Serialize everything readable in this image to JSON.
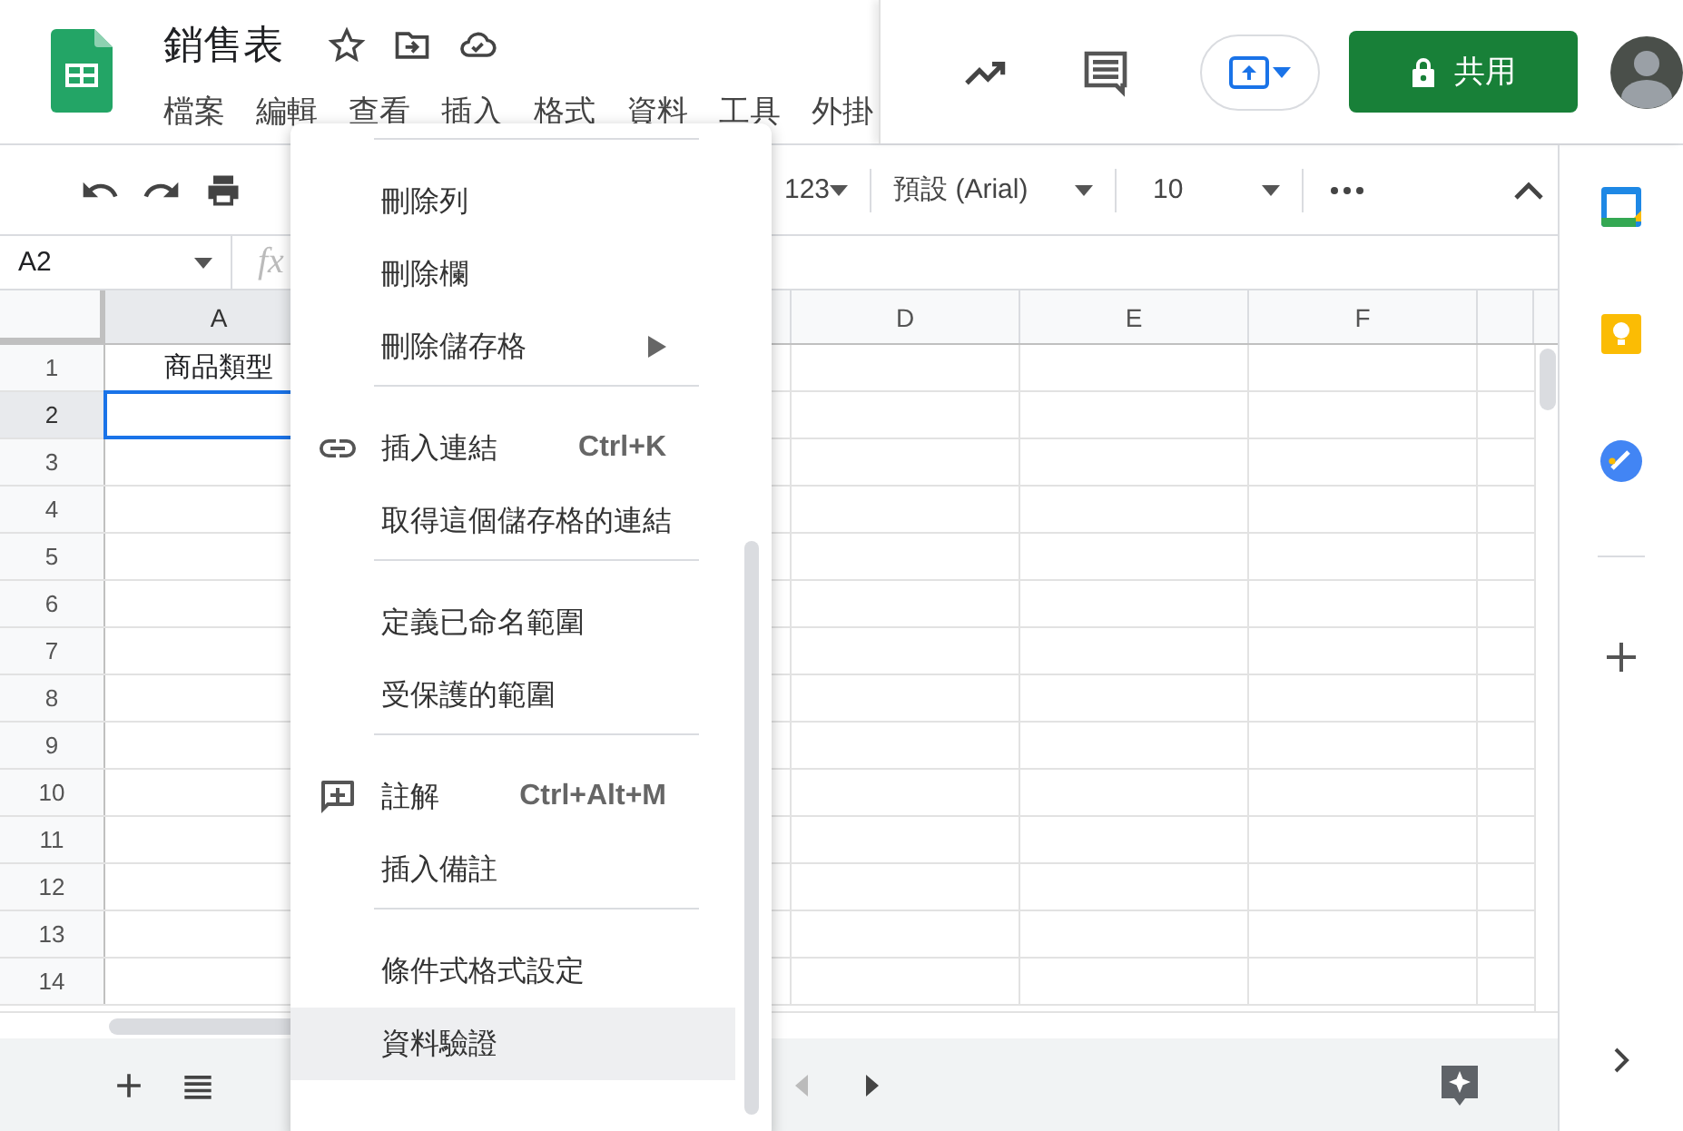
{
  "document": {
    "title": "銷售表"
  },
  "menu_bar": [
    "檔案",
    "編輯",
    "查看",
    "插入",
    "格式",
    "資料",
    "工具",
    "外掛"
  ],
  "share_button": {
    "label": "共用"
  },
  "toolbar": {
    "number_format": "123",
    "font": "預設 (Arial)",
    "font_size": "10"
  },
  "name_box": "A2",
  "formula_label": "fx",
  "columns": [
    {
      "label": "A",
      "selected": true
    },
    {
      "label": "D",
      "selected": false
    },
    {
      "label": "E",
      "selected": false
    },
    {
      "label": "F",
      "selected": false
    }
  ],
  "rows": [
    {
      "number": "1",
      "selected": false,
      "cell_a": "商品類型"
    },
    {
      "number": "2",
      "selected": true
    },
    {
      "number": "3",
      "selected": false
    },
    {
      "number": "4",
      "selected": false
    },
    {
      "number": "5",
      "selected": false
    },
    {
      "number": "6",
      "selected": false
    },
    {
      "number": "7",
      "selected": false
    },
    {
      "number": "8",
      "selected": false
    },
    {
      "number": "9",
      "selected": false
    },
    {
      "number": "10",
      "selected": false
    },
    {
      "number": "11",
      "selected": false
    },
    {
      "number": "12",
      "selected": false
    },
    {
      "number": "13",
      "selected": false
    },
    {
      "number": "14",
      "selected": false
    }
  ],
  "context_menu": [
    {
      "kind": "divider"
    },
    {
      "kind": "item",
      "label": "刪除列",
      "selected": false,
      "submenu": false
    },
    {
      "kind": "item",
      "label": "刪除欄",
      "selected": false,
      "submenu": false
    },
    {
      "kind": "item",
      "label": "刪除儲存格",
      "selected": false,
      "submenu": true
    },
    {
      "kind": "divider"
    },
    {
      "kind": "link",
      "label": "插入連結",
      "shortcut": "Ctrl+K",
      "selected": false,
      "submenu": false
    },
    {
      "kind": "item",
      "label": "取得這個儲存格的連結",
      "selected": false,
      "submenu": false
    },
    {
      "kind": "divider"
    },
    {
      "kind": "item",
      "label": "定義已命名範圍",
      "selected": false,
      "submenu": false
    },
    {
      "kind": "item",
      "label": "受保護的範圍",
      "selected": false,
      "submenu": false
    },
    {
      "kind": "divider"
    },
    {
      "kind": "comment",
      "label": "註解",
      "shortcut": "Ctrl+Alt+M",
      "selected": false,
      "submenu": false
    },
    {
      "kind": "item",
      "label": "插入備註",
      "selected": false,
      "submenu": false
    },
    {
      "kind": "divider"
    },
    {
      "kind": "item",
      "label": "條件式格式設定",
      "selected": false,
      "submenu": false
    },
    {
      "kind": "item",
      "label": "資料驗證",
      "selected": true,
      "submenu": false
    }
  ]
}
